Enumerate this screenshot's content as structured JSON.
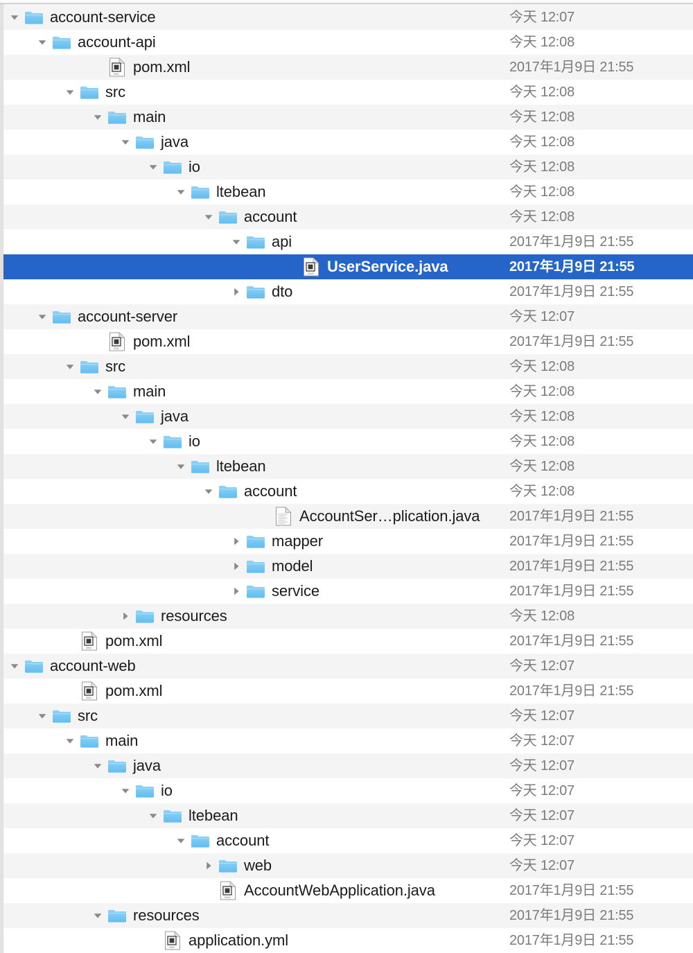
{
  "view": {
    "kind": "file-tree-outline",
    "accent_selection_color": "#2565ca",
    "row_alt_color": "#f4f4f4",
    "folder_icon_color": "#6cc2f2",
    "columns": [
      "name",
      "date-modified"
    ]
  },
  "rows": [
    {
      "name": "account-service",
      "date": "今天 12:07",
      "depth": 0,
      "icon": "folder-icon",
      "twisty": "down",
      "selected": false
    },
    {
      "name": "account-api",
      "date": "今天 12:08",
      "depth": 1,
      "icon": "folder-icon",
      "twisty": "down",
      "selected": false
    },
    {
      "name": "pom.xml",
      "date": "2017年1月9日 21:55",
      "depth": 3,
      "icon": "xml-file-icon",
      "twisty": "none",
      "selected": false
    },
    {
      "name": "src",
      "date": "今天 12:08",
      "depth": 2,
      "icon": "folder-icon",
      "twisty": "down",
      "selected": false
    },
    {
      "name": "main",
      "date": "今天 12:08",
      "depth": 3,
      "icon": "folder-icon",
      "twisty": "down",
      "selected": false
    },
    {
      "name": "java",
      "date": "今天 12:08",
      "depth": 4,
      "icon": "folder-icon",
      "twisty": "down",
      "selected": false
    },
    {
      "name": "io",
      "date": "今天 12:08",
      "depth": 5,
      "icon": "folder-icon",
      "twisty": "down",
      "selected": false
    },
    {
      "name": "ltebean",
      "date": "今天 12:08",
      "depth": 6,
      "icon": "folder-icon",
      "twisty": "down",
      "selected": false
    },
    {
      "name": "account",
      "date": "今天 12:08",
      "depth": 7,
      "icon": "folder-icon",
      "twisty": "down",
      "selected": false
    },
    {
      "name": "api",
      "date": "2017年1月9日 21:55",
      "depth": 8,
      "icon": "folder-icon",
      "twisty": "down",
      "selected": false
    },
    {
      "name": "UserService.java",
      "date": "2017年1月9日 21:55",
      "depth": 10,
      "icon": "java-file-icon",
      "twisty": "none",
      "selected": true
    },
    {
      "name": "dto",
      "date": "2017年1月9日 21:55",
      "depth": 8,
      "icon": "folder-icon",
      "twisty": "right",
      "selected": false
    },
    {
      "name": "account-server",
      "date": "今天 12:07",
      "depth": 1,
      "icon": "folder-icon",
      "twisty": "down",
      "selected": false
    },
    {
      "name": "pom.xml",
      "date": "2017年1月9日 21:55",
      "depth": 3,
      "icon": "xml-file-icon",
      "twisty": "none",
      "selected": false
    },
    {
      "name": "src",
      "date": "今天 12:08",
      "depth": 2,
      "icon": "folder-icon",
      "twisty": "down",
      "selected": false
    },
    {
      "name": "main",
      "date": "今天 12:08",
      "depth": 3,
      "icon": "folder-icon",
      "twisty": "down",
      "selected": false
    },
    {
      "name": "java",
      "date": "今天 12:08",
      "depth": 4,
      "icon": "folder-icon",
      "twisty": "down",
      "selected": false
    },
    {
      "name": "io",
      "date": "今天 12:08",
      "depth": 5,
      "icon": "folder-icon",
      "twisty": "down",
      "selected": false
    },
    {
      "name": "ltebean",
      "date": "今天 12:08",
      "depth": 6,
      "icon": "folder-icon",
      "twisty": "down",
      "selected": false
    },
    {
      "name": "account",
      "date": "今天 12:08",
      "depth": 7,
      "icon": "folder-icon",
      "twisty": "down",
      "selected": false
    },
    {
      "name": "AccountSer…plication.java",
      "date": "2017年1月9日 21:55",
      "depth": 9,
      "icon": "text-file-icon",
      "twisty": "none",
      "selected": false
    },
    {
      "name": "mapper",
      "date": "2017年1月9日 21:55",
      "depth": 8,
      "icon": "folder-icon",
      "twisty": "right",
      "selected": false
    },
    {
      "name": "model",
      "date": "2017年1月9日 21:55",
      "depth": 8,
      "icon": "folder-icon",
      "twisty": "right",
      "selected": false
    },
    {
      "name": "service",
      "date": "2017年1月9日 21:55",
      "depth": 8,
      "icon": "folder-icon",
      "twisty": "right",
      "selected": false
    },
    {
      "name": "resources",
      "date": "今天 12:08",
      "depth": 4,
      "icon": "folder-icon",
      "twisty": "right",
      "selected": false
    },
    {
      "name": "pom.xml",
      "date": "2017年1月9日 21:55",
      "depth": 2,
      "icon": "xml-file-icon",
      "twisty": "none",
      "selected": false
    },
    {
      "name": "account-web",
      "date": "今天 12:07",
      "depth": 0,
      "icon": "folder-icon",
      "twisty": "down",
      "selected": false
    },
    {
      "name": "pom.xml",
      "date": "2017年1月9日 21:55",
      "depth": 2,
      "icon": "xml-file-icon",
      "twisty": "none",
      "selected": false
    },
    {
      "name": "src",
      "date": "今天 12:07",
      "depth": 1,
      "icon": "folder-icon",
      "twisty": "down",
      "selected": false
    },
    {
      "name": "main",
      "date": "今天 12:07",
      "depth": 2,
      "icon": "folder-icon",
      "twisty": "down",
      "selected": false
    },
    {
      "name": "java",
      "date": "今天 12:07",
      "depth": 3,
      "icon": "folder-icon",
      "twisty": "down",
      "selected": false
    },
    {
      "name": "io",
      "date": "今天 12:07",
      "depth": 4,
      "icon": "folder-icon",
      "twisty": "down",
      "selected": false
    },
    {
      "name": "ltebean",
      "date": "今天 12:07",
      "depth": 5,
      "icon": "folder-icon",
      "twisty": "down",
      "selected": false
    },
    {
      "name": "account",
      "date": "今天 12:07",
      "depth": 6,
      "icon": "folder-icon",
      "twisty": "down",
      "selected": false
    },
    {
      "name": "web",
      "date": "今天 12:07",
      "depth": 7,
      "icon": "folder-icon",
      "twisty": "right",
      "selected": false
    },
    {
      "name": "AccountWebApplication.java",
      "date": "2017年1月9日 21:55",
      "depth": 7,
      "icon": "java-file-icon",
      "twisty": "none",
      "selected": false
    },
    {
      "name": "resources",
      "date": "2017年1月9日 21:55",
      "depth": 3,
      "icon": "folder-icon",
      "twisty": "down",
      "selected": false
    },
    {
      "name": "application.yml",
      "date": "2017年1月9日 21:55",
      "depth": 5,
      "icon": "xml-file-icon",
      "twisty": "none",
      "selected": false
    }
  ]
}
